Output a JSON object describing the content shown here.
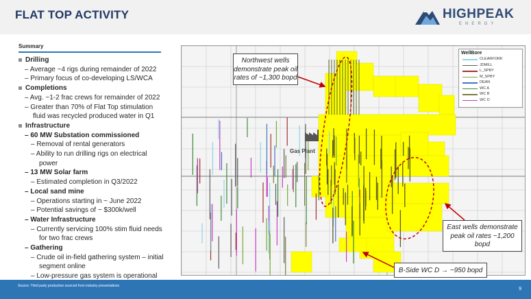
{
  "header": {
    "title": "FLAT TOP ACTIVITY",
    "logo_text": "HIGHPEAK",
    "logo_subtext": "ENERGY",
    "logo_colors": {
      "main": "#2e4a74",
      "accent": "#6fa8dc",
      "sub": "#6b7d99"
    }
  },
  "summary": {
    "title": "Summary",
    "lines": [
      {
        "level": "l1",
        "text": "Drilling"
      },
      {
        "level": "l2",
        "text": "– Average ~4 rigs during remainder of 2022"
      },
      {
        "level": "l2",
        "text": "– Primary focus of co-developing LS/WCA"
      },
      {
        "level": "l1",
        "text": "Completions"
      },
      {
        "level": "l2",
        "text": "– Avg. ~1-2 frac crews for remainder of 2022"
      },
      {
        "level": "l2",
        "text": "– Greater than 70% of Flat Top stimulation"
      },
      {
        "level": "l2c",
        "text": "fluid was recycled produced water in Q1"
      },
      {
        "level": "l1",
        "text": "Infrastructure"
      },
      {
        "level": "l2b",
        "text": "– 60 MW Substation commissioned"
      },
      {
        "level": "l3",
        "text": "– Removal of rental generators"
      },
      {
        "level": "l3",
        "text": "– Ability to run drilling rigs on electrical"
      },
      {
        "level": "l3c",
        "text": "power"
      },
      {
        "level": "l2b",
        "text": "– 13 MW Solar farm"
      },
      {
        "level": "l3",
        "text": "– Estimated completion in Q3/2022"
      },
      {
        "level": "l2b",
        "text": "– Local sand mine"
      },
      {
        "level": "l3",
        "text": "– Operations starting in ~ June 2022"
      },
      {
        "level": "l3",
        "text": "– Potential savings of ~ $300k/well"
      },
      {
        "level": "l2b",
        "text": "– Water Infrastructure"
      },
      {
        "level": "l3",
        "text": "– Currently servicing 100% stim fluid needs"
      },
      {
        "level": "l3c",
        "text": "for two frac crews"
      },
      {
        "level": "l2b",
        "text": "– Gathering"
      },
      {
        "level": "l3",
        "text": "– Crude oil in-field gathering system – initial"
      },
      {
        "level": "l3c",
        "text": "segment online"
      },
      {
        "level": "l3",
        "text": "– Low-pressure gas system is operational"
      }
    ]
  },
  "map": {
    "gas_plant_label": "Gas Plant",
    "gas_plant_icon": "factory-icon",
    "acreage_color": "#ffff00",
    "ellipse_color": "#c00000",
    "legend": {
      "title": "WellBore",
      "items": [
        {
          "label": "CLEARFORK",
          "color": "#8fd3e8"
        },
        {
          "label": "JDMILL",
          "color": "#5b5b5b"
        },
        {
          "label": "L_SPBY",
          "color": "#a0302a"
        },
        {
          "label": "M_SPBY",
          "color": "#7aa63a"
        },
        {
          "label": "DEAN",
          "color": "#4472c4"
        },
        {
          "label": "WC A",
          "color": "#3a8a3a"
        },
        {
          "label": "WC B",
          "color": "#7b7b3a"
        },
        {
          "label": "WC D",
          "color": "#c040c0"
        }
      ]
    }
  },
  "callouts": {
    "northwest": "Northwest wells demonstrate peak oil rates of ~1,300 bopd",
    "east": "East wells demonstrate peak oil rates ~1,200 bopd",
    "bside": "B-Side WC D → ~950 bopd"
  },
  "footer": {
    "source": "Source:  Third party production sourced from industry presentations",
    "page": "9",
    "bar_color": "#2e75b6"
  }
}
